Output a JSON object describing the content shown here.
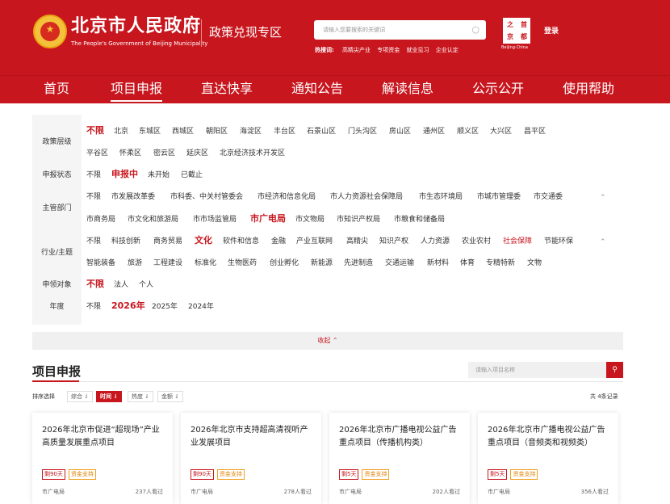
{
  "header": {
    "brand_cn": "北京市人民政府",
    "brand_en": "The People's Government of Beijing Municipality",
    "zone": "政策兑现专区",
    "search_placeholder": "请输入您要搜索的关键词",
    "hot_label": "热搜词:",
    "hot_words": [
      "高精尖产业",
      "专项资金",
      "就业见习",
      "企业认定"
    ],
    "seal_chars": [
      "首",
      "之",
      "都",
      "京"
    ],
    "seal_caption": "Beijing·China",
    "login": "登录"
  },
  "nav": [
    "首页",
    "项目申报",
    "直达快享",
    "通知公告",
    "解读信息",
    "公示公开",
    "使用帮助"
  ],
  "filters": {
    "level": {
      "label": "政策层级",
      "row1": [
        "不限",
        "北京",
        "东城区",
        "西城区",
        "朝阳区",
        "海淀区",
        "丰台区",
        "石景山区",
        "门头沟区",
        "房山区",
        "通州区",
        "顺义区",
        "大兴区",
        "昌平区"
      ],
      "row2": [
        "平谷区",
        "怀柔区",
        "密云区",
        "延庆区",
        "北京经济技术开发区"
      ]
    },
    "status": {
      "label": "申报状态",
      "options": [
        "不限",
        "申报中",
        "未开始",
        "已截止"
      ]
    },
    "dept": {
      "label": "主管部门",
      "row1": [
        "不限",
        "市发展改革委",
        "市科委、中关村管委会",
        "市经济和信息化局",
        "市人力资源社会保障局",
        "市生态环境局",
        "市城市管理委",
        "市交通委"
      ],
      "row2": [
        "市商务局",
        "市文化和旅游局",
        "市市场监管局",
        "市广电局",
        "市文物局",
        "市知识产权局",
        "市粮食和储备局"
      ]
    },
    "industry": {
      "label": "行业/主题",
      "row1": [
        "不限",
        "科技创新",
        "商务贸易",
        "文化",
        "软件和信息",
        "金融",
        "产业互联网",
        "高精尖",
        "知识产权",
        "人力资源",
        "农业农村",
        "社会保障",
        "节能环保"
      ],
      "row2": [
        "智能装备",
        "旅游",
        "工程建设",
        "标准化",
        "生物医药",
        "创业孵化",
        "新能源",
        "先进制造",
        "交通运输",
        "新材料",
        "体育",
        "专精特新",
        "文物"
      ]
    },
    "target": {
      "label": "申领对象",
      "options": [
        "不限",
        "法人",
        "个人"
      ]
    },
    "year": {
      "label": "年度",
      "options": [
        "不限",
        "2026年",
        "2025年",
        "2024年"
      ]
    },
    "caret": "⌃",
    "collapse": "收起 ⌃"
  },
  "section": {
    "title": "项目申报",
    "search_placeholder": "请输入项目名称",
    "sort_label": "排序选择",
    "sort_options": [
      "综合 ⇃",
      "时间 ⇃",
      "热度 ⇃",
      "金额 ⇃"
    ],
    "total": "共 4条记录"
  },
  "cards": [
    {
      "title": "2026年北京市促进“超现场”产业高质量发展重点项目",
      "remain": "剩90天",
      "tag": "资金支持",
      "dept": "市广电局",
      "views": "237人看过"
    },
    {
      "title": "2026年北京市支持超高清视听产业发展项目",
      "remain": "剩90天",
      "tag": "资金支持",
      "dept": "市广电局",
      "views": "278人看过"
    },
    {
      "title": "2026年北京市广播电视公益广告重点项目（传播机构类）",
      "remain": "剩5天",
      "tag": "资金支持",
      "dept": "市广电局",
      "views": "202人看过"
    },
    {
      "title": "2026年北京市广播电视公益广告重点项目（音频类和视频类）",
      "remain": "剩5天",
      "tag": "资金支持",
      "dept": "市广电局",
      "views": "356人看过"
    }
  ],
  "colors": {
    "brand_red": "#c8161e",
    "filter_bg": "#f5f5f5",
    "tag_orange": "#e08000"
  }
}
